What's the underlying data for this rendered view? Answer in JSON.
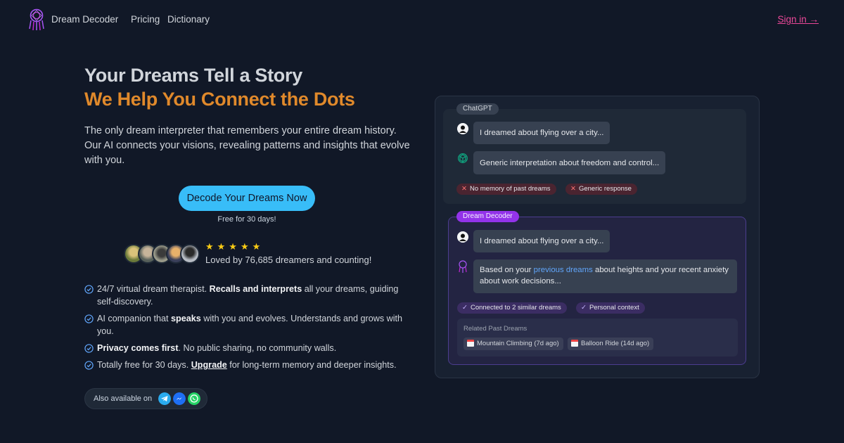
{
  "nav": {
    "brand": "Dream Decoder",
    "links": [
      "Pricing",
      "Dictionary"
    ],
    "signin": "Sign in →"
  },
  "hero": {
    "title_line1": "Your Dreams Tell a Story",
    "title_line2": "We Help You Connect the Dots",
    "lead": "The only dream interpreter that remembers your entire dream history. Our AI connects your visions, revealing patterns and insights that evolve with you.",
    "cta": "Decode Your Dreams Now",
    "cta_sub": "Free for 30 days!",
    "rating_stars": 5,
    "loved": "Loved by 76,685 dreamers and counting!"
  },
  "features": [
    {
      "pre": "24/7 virtual dream therapist. ",
      "bold": "Recalls and interprets",
      "post": " all your dreams, guiding self-discovery."
    },
    {
      "pre": "AI companion that ",
      "bold": "speaks",
      "post": " with you and evolves. Understands and grows with you."
    },
    {
      "pre": "",
      "bold": "Privacy comes first",
      "post": ". No public sharing, no community walls."
    },
    {
      "pre": "Totally free for 30 days. ",
      "link": "Upgrade",
      "post": " for long-term memory and deeper insights."
    }
  ],
  "available": {
    "label": "Also available on",
    "icons": [
      "telegram-icon",
      "messenger-icon",
      "whatsapp-icon"
    ]
  },
  "compare": {
    "chatgpt": {
      "tag": "ChatGPT",
      "user_msg": "I dreamed about flying over a city...",
      "reply": "Generic interpretation about freedom and control...",
      "badges": [
        "No memory of past dreams",
        "Generic response"
      ]
    },
    "decoder": {
      "tag": "Dream Decoder",
      "user_msg": "I dreamed about flying over a city...",
      "reply_pre": "Based on your ",
      "reply_highlight": "previous dreams",
      "reply_post": " about heights and your recent anxiety about work decisions...",
      "badges": [
        "Connected to 2 similar dreams",
        "Personal context"
      ],
      "related_title": "Related Past Dreams",
      "related": [
        "Mountain Climbing (7d ago)",
        "Balloon Ride (14d ago)"
      ]
    }
  },
  "colors": {
    "accent_orange": "#e0892b",
    "cta_blue": "#38bdf8",
    "signin_pink": "#ec4899",
    "decoder_purple": "#9333ea"
  }
}
